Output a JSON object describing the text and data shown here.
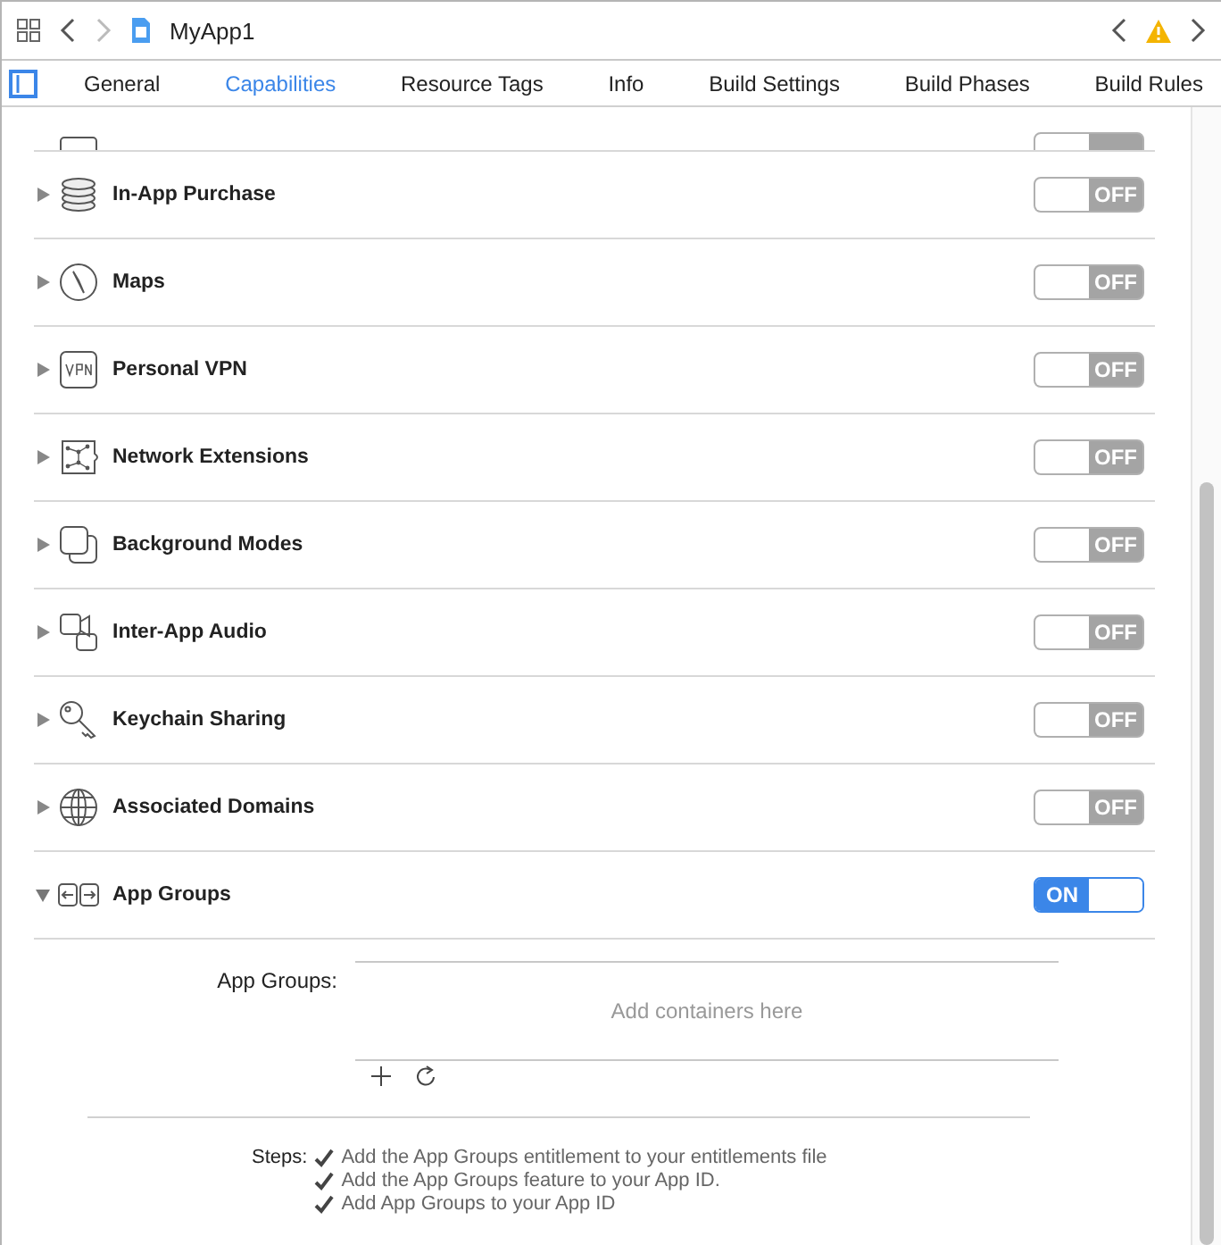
{
  "toolbar": {
    "title": "MyApp1"
  },
  "tabs": [
    {
      "label": "General",
      "selected": false
    },
    {
      "label": "Capabilities",
      "selected": true
    },
    {
      "label": "Resource Tags",
      "selected": false
    },
    {
      "label": "Info",
      "selected": false
    },
    {
      "label": "Build Settings",
      "selected": false
    },
    {
      "label": "Build Phases",
      "selected": false
    },
    {
      "label": "Build Rules",
      "selected": false
    }
  ],
  "partial_row": {
    "on": false
  },
  "capabilities": [
    {
      "name": "In-App Purchase",
      "on": false,
      "expanded": false,
      "switch_text": "OFF"
    },
    {
      "name": "Maps",
      "on": false,
      "expanded": false,
      "switch_text": "OFF"
    },
    {
      "name": "Personal VPN",
      "on": false,
      "expanded": false,
      "switch_text": "OFF"
    },
    {
      "name": "Network Extensions",
      "on": false,
      "expanded": false,
      "switch_text": "OFF"
    },
    {
      "name": "Background Modes",
      "on": false,
      "expanded": false,
      "switch_text": "OFF"
    },
    {
      "name": "Inter-App Audio",
      "on": false,
      "expanded": false,
      "switch_text": "OFF"
    },
    {
      "name": "Keychain Sharing",
      "on": false,
      "expanded": false,
      "switch_text": "OFF"
    },
    {
      "name": "Associated Domains",
      "on": false,
      "expanded": false,
      "switch_text": "OFF"
    },
    {
      "name": "App Groups",
      "on": true,
      "expanded": true,
      "switch_text": "ON"
    }
  ],
  "app_groups": {
    "label": "App Groups:",
    "placeholder": "Add containers here"
  },
  "steps": {
    "label": "Steps:",
    "items": [
      {
        "text": "Add the App Groups entitlement to your entitlements file",
        "done": true
      },
      {
        "text": "Add the App Groups feature to your App ID.",
        "done": true
      },
      {
        "text": "Add App Groups to your App ID",
        "done": true
      }
    ]
  }
}
